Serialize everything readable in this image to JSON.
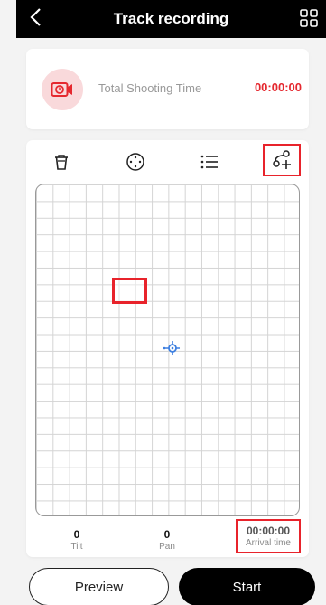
{
  "header": {
    "title": "Track recording",
    "back_icon": "chevron-left-icon",
    "menu_icon": "grid-menu-icon"
  },
  "shooting": {
    "label": "Total Shooting Time",
    "value": "00:00:00",
    "icon": "camera-timer-icon"
  },
  "toolbar": {
    "icons": [
      "trash-icon",
      "target-icon",
      "list-icon",
      "add-point-icon"
    ]
  },
  "stats": {
    "tilt": {
      "value": "0",
      "label": "Tilt"
    },
    "pan": {
      "value": "0",
      "label": "Pan"
    },
    "arrival": {
      "value": "00:00:00",
      "label": "Arrival time"
    }
  },
  "buttons": {
    "preview": "Preview",
    "start": "Start"
  },
  "colors": {
    "accent_red": "#e5282f",
    "crosshair_blue": "#3d7fe0",
    "header_bg": "#000000"
  }
}
